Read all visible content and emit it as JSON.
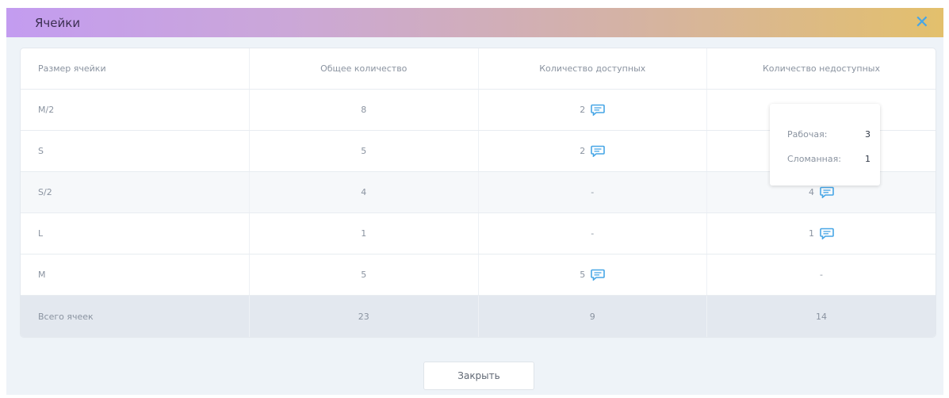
{
  "dialog": {
    "title": "Ячейки",
    "close_icon": "✕",
    "accent": "#47a6e6"
  },
  "table": {
    "headers": [
      "Размер ячейки",
      "Общее количество",
      "Количество доступных",
      "Количество недоступных"
    ],
    "rows": [
      {
        "size": "M/2",
        "total": "8",
        "available": "2",
        "available_icon": true,
        "unavailable": "",
        "unavailable_icon": false
      },
      {
        "size": "S",
        "total": "5",
        "available": "2",
        "available_icon": true,
        "unavailable": "",
        "unavailable_icon": false
      },
      {
        "size": "S/2",
        "total": "4",
        "available": "-",
        "available_icon": false,
        "unavailable": "4",
        "unavailable_icon": true
      },
      {
        "size": "L",
        "total": "1",
        "available": "-",
        "available_icon": false,
        "unavailable": "1",
        "unavailable_icon": true
      },
      {
        "size": "M",
        "total": "5",
        "available": "5",
        "available_icon": true,
        "unavailable": "-",
        "unavailable_icon": false
      }
    ],
    "total_row": {
      "label": "Всего ячеек",
      "total": "23",
      "available": "9",
      "unavailable": "14"
    }
  },
  "tooltip": {
    "rows": [
      {
        "label": "Рабочая:",
        "value": "3"
      },
      {
        "label": "Сломанная:",
        "value": "1"
      }
    ]
  },
  "footer": {
    "close_button": "Закрыть"
  }
}
